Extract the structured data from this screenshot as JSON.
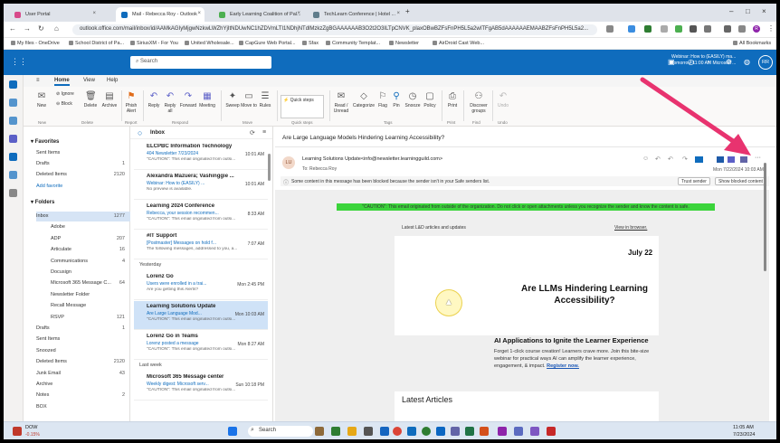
{
  "browser": {
    "tabs": [
      {
        "label": "User Portal",
        "color": "#d84a8a"
      },
      {
        "label": "Mail - Rebecca Roy - Outlook",
        "color": "#0f6cbd",
        "active": true
      },
      {
        "label": "Early Learning Coalition of Pal...",
        "color": "#4caf50"
      },
      {
        "label": "TechLearn Conference | Hotel ...",
        "color": "#607d8b"
      }
    ],
    "url": "outlook.office.com/mail/inbox/id/AAMkAGIyMjgwNzkwLWZhYjItNDUwNC1hZDVmLTI1NDhjNTdlMzkzZgBGAAAAAAB3O2t2O3ILTpCNVK_plaxOBwBZFsFnPH5L5a2wITFgAB5dAAAAAAEMAABZFsFnPH5L5a2...",
    "bookmarks": [
      "My files - OneDrive",
      "School District of Pa...",
      "SiriusXM - For You",
      "United Wholesale...",
      "CapGure Web Portal...",
      "Sfax",
      "Community Templat...",
      "Newsletter",
      "AirDroid Cast Web...",
      "All Bookmarks"
    ],
    "profile_initial": "R"
  },
  "outlook": {
    "search_placeholder": "Search",
    "header_note_title": "Webinar: How to (EASILY) ma...",
    "header_note_time": "Tomorrow 11:00 AM Microsoft ...",
    "avatar": "RR",
    "ribbon_tabs": [
      "Home",
      "View",
      "Help"
    ],
    "ribbon_buttons": [
      {
        "label": "New",
        "icon": "new-mail-icon"
      },
      {
        "label": "Ignore",
        "icon": "ignore-icon"
      },
      {
        "label": "Block",
        "icon": "block-icon"
      },
      {
        "label": "Delete",
        "icon": "delete-icon"
      },
      {
        "label": "Archive",
        "icon": "archive-icon"
      },
      {
        "label": "Phish Alert",
        "icon": "phish-alert-icon"
      },
      {
        "label": "Reply",
        "icon": "reply-icon"
      },
      {
        "label": "Reply all",
        "icon": "reply-all-icon"
      },
      {
        "label": "Forward",
        "icon": "forward-icon"
      },
      {
        "label": "Meeting",
        "icon": "meeting-icon"
      },
      {
        "label": "Sweep",
        "icon": "sweep-icon"
      },
      {
        "label": "Move to",
        "icon": "move-icon"
      },
      {
        "label": "Rules",
        "icon": "rules-icon"
      },
      {
        "label": "Quick steps",
        "icon": "quick-steps-icon"
      },
      {
        "label": "Read / Unread",
        "icon": "read-unread-icon"
      },
      {
        "label": "Categorize",
        "icon": "categorize-icon"
      },
      {
        "label": "Flag",
        "icon": "flag-icon"
      },
      {
        "label": "Pin",
        "icon": "pin-icon"
      },
      {
        "label": "Snooze",
        "icon": "snooze-icon"
      },
      {
        "label": "Policy",
        "icon": "policy-icon"
      },
      {
        "label": "Print",
        "icon": "print-icon"
      },
      {
        "label": "Discover groups",
        "icon": "groups-icon"
      },
      {
        "label": "Undo",
        "icon": "undo-icon"
      }
    ],
    "ribbon_groups": [
      "New",
      "Delete",
      "Report",
      "Respond",
      "Move",
      "Quick steps",
      "Tags",
      "Print",
      "Find",
      "Undo"
    ],
    "favorites_title": "Favorites",
    "favorites": [
      {
        "label": "Sent Items",
        "count": ""
      },
      {
        "label": "Drafts",
        "count": "1"
      },
      {
        "label": "Deleted Items",
        "count": "2120"
      },
      {
        "label": "Add favorite",
        "count": ""
      }
    ],
    "folders_title": "Folders",
    "folders": [
      {
        "label": "Inbox",
        "count": "1277",
        "sub": false,
        "selected": true
      },
      {
        "label": "Adobe",
        "count": "",
        "sub": true
      },
      {
        "label": "ADP",
        "count": "207",
        "sub": true
      },
      {
        "label": "Articulate",
        "count": "16",
        "sub": true
      },
      {
        "label": "Communications",
        "count": "4",
        "sub": true
      },
      {
        "label": "Docusign",
        "count": "",
        "sub": true
      },
      {
        "label": "Microsoft 365 Message C...",
        "count": "64",
        "sub": true
      },
      {
        "label": "Newsletter Folder",
        "count": "",
        "sub": true
      },
      {
        "label": "Recall Message",
        "count": "",
        "sub": true
      },
      {
        "label": "RSVP",
        "count": "121",
        "sub": true
      },
      {
        "label": "Drafts",
        "count": "1",
        "sub": false
      },
      {
        "label": "Sent Items",
        "count": "",
        "sub": false
      },
      {
        "label": "Snoozed",
        "count": "",
        "sub": false
      },
      {
        "label": "Deleted Items",
        "count": "2120",
        "sub": false
      },
      {
        "label": "Junk Email",
        "count": "43",
        "sub": false
      },
      {
        "label": "Archive",
        "count": "",
        "sub": false
      },
      {
        "label": "Notes",
        "count": "2",
        "sub": false
      },
      {
        "label": "BOX",
        "count": "",
        "sub": false
      }
    ],
    "list_title": "Inbox",
    "messages_top": [
      {
        "from": "ELCPBC Information Technology",
        "subject": "404 Newsletter 7/23/2024",
        "time": "10:01 AM",
        "preview": "\"CAUTION\": This email originated from outsi..."
      },
      {
        "from": "Alexandra Mazuera; Vashinggie ...",
        "subject": "Webinar: How to (EASILY) ...",
        "time": "10:01 AM",
        "preview": "No preview is available."
      },
      {
        "from": "Learning 2024 Conference",
        "subject": "Rebecca, your session recommen...",
        "time": "8:33 AM",
        "preview": "\"CAUTION\": This email originated from outsi..."
      },
      {
        "from": "#IT Support",
        "subject": "[Postmaster] Messages on hold f...",
        "time": "7:07 AM",
        "preview": "The following messages, addressed to you, a..."
      }
    ],
    "group_yesterday": "Yesterday",
    "messages_yesterday": [
      {
        "from": "Lorenz Go",
        "subject": "Users were enrolled in a trai...",
        "time": "Mon 2:45 PM",
        "preview": "Are you getting this Alerts?"
      },
      {
        "from": "Learning Solutions Update",
        "subject": "Are Large Language Mod...",
        "time": "Mon 10:03 AM",
        "preview": "\"CAUTION\": This email originated from outsi...",
        "selected": true
      },
      {
        "from": "Lorenz Go in Teams",
        "subject": "Lorenz posted a message",
        "time": "Mon 8:27 AM",
        "preview": "\"CAUTION\": This email originated from outsi..."
      }
    ],
    "group_lastweek": "Last week",
    "messages_lastweek": [
      {
        "from": "Microsoft 365 Message center",
        "subject": "Weekly digest: Microsoft serv...",
        "time": "Sun 10:18 PM",
        "preview": "\"CAUTION\": This email originated from outsi..."
      }
    ],
    "reading": {
      "subject": "Are Large Language Models Hindering Learning Accessibility?",
      "sender_initials": "LU",
      "sender": "Learning Solutions Update<info@newsletter.learningguild.com>",
      "to": "To: Rebecca Roy",
      "date": "Mon 7/22/2024 10:03 AM",
      "blocked_text": "Some content in this message has been blocked because the sender isn't in your Safe senders list.",
      "trust_btn": "Trust sender",
      "show_btn": "Show blocked content",
      "caution": "\"CAUTION\": This email originated from outside of the organization. Do not click or open attachments unless you recognize the sender and know the content is safe.",
      "preheader": "Latest L&D articles and updates",
      "view_browser": "View in browser.",
      "date_label": "July 22",
      "headline": "Are LLMs Hindering Learning Accessibility?",
      "ad_title": "AI Applications to Ignite the Learner Experience",
      "ad_body": "Forget 1-click course creation! Learners crave more. Join this bite-size webinar for practical ways AI can amplify the learner experience, engagement, & impact.",
      "ad_link": "Register now.",
      "latest": "Latest Articles"
    }
  },
  "taskbar": {
    "weather_label": "DOW",
    "weather_value": "-0.15%",
    "search": "Search",
    "time": "11:05 AM",
    "date": "7/23/2024"
  }
}
